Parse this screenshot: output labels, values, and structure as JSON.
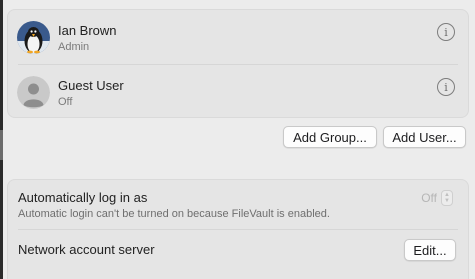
{
  "users": [
    {
      "name": "Ian Brown",
      "role": "Admin",
      "avatar": "penguin-avatar",
      "info_icon": "info-icon"
    },
    {
      "name": "Guest User",
      "role": "Off",
      "avatar": "generic-user-avatar",
      "info_icon": "info-icon"
    }
  ],
  "buttons": {
    "add_group": "Add Group...",
    "add_user": "Add User..."
  },
  "auto_login": {
    "title": "Automatically log in as",
    "value": "Off",
    "description": "Automatic login can't be turned on because FileVault is enabled."
  },
  "network": {
    "label": "Network account server",
    "button": "Edit..."
  },
  "info_glyph": "i",
  "stepper_glyphs": {
    "up": "▲",
    "down": "▼"
  }
}
